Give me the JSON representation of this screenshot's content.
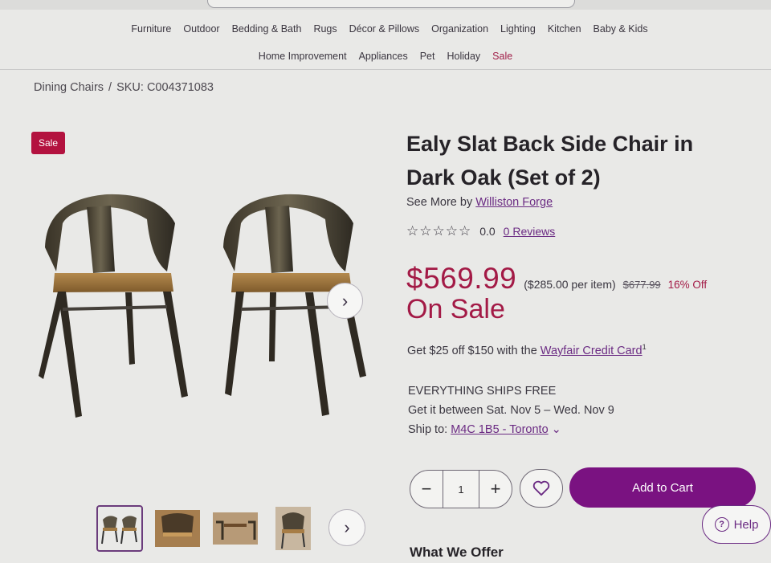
{
  "nav": {
    "row1": [
      "Furniture",
      "Outdoor",
      "Bedding & Bath",
      "Rugs",
      "Décor & Pillows",
      "Organization",
      "Lighting",
      "Kitchen",
      "Baby & Kids"
    ],
    "row2": [
      "Home Improvement",
      "Appliances",
      "Pet",
      "Holiday",
      "Sale"
    ]
  },
  "breadcrumb": {
    "category": "Dining Chairs",
    "separator": "/",
    "sku": "SKU: C004371083"
  },
  "gallery": {
    "badge": "Sale",
    "thumbnails": [
      "chair-pair",
      "chair-side",
      "dining-set",
      "chair-single"
    ]
  },
  "product": {
    "title": "Ealy Slat Back Side Chair in Dark Oak (Set of 2)",
    "see_more_prefix": "See More by",
    "brand": "Williston Forge",
    "rating_value": "0.0",
    "stars": "☆☆☆☆☆",
    "reviews": "0 Reviews",
    "price": "$569.99",
    "per_item": "($285.00 per item)",
    "original_price": "$677.99",
    "percent_off": "16% Off",
    "on_sale": "On Sale",
    "credit_prefix": "Get $25 off $150 with the",
    "credit_link": "Wayfair Credit Card",
    "credit_footnote": "1",
    "shipping_headline": "EVERYTHING SHIPS FREE",
    "delivery": "Get it between Sat. Nov 5 – Wed. Nov 9",
    "ship_to_prefix": "Ship to:",
    "ship_to": "M4C 1B5 - Toronto"
  },
  "purchase": {
    "quantity": "1",
    "minus": "−",
    "plus": "+",
    "add_to_cart": "Add to Cart"
  },
  "help": {
    "label": "Help",
    "icon": "?"
  },
  "section": {
    "what_we_offer": "What We Offer"
  },
  "colors": {
    "accent": "#7a1281",
    "sale": "#a31a46",
    "badge": "#b3123f"
  }
}
